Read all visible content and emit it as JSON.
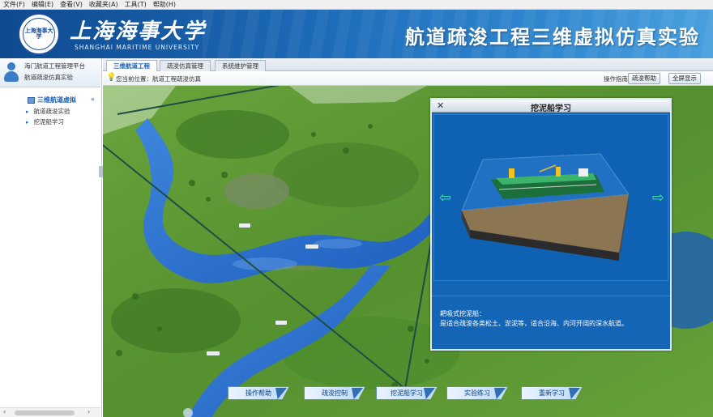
{
  "menubar": {
    "items": [
      "文件(F)",
      "编辑(E)",
      "查看(V)",
      "收藏夹(A)",
      "工具(T)",
      "帮助(H)"
    ]
  },
  "banner": {
    "seal_text": "上海海事大学",
    "university_cn": "上海海事大学",
    "university_en": "SHANGHAI MARITIME UNIVERSITY",
    "app_title": "航道疏浚工程三维虚拟仿真实验"
  },
  "sidebar": {
    "user_line1": "海门航道工程管理平台",
    "user_line2": "航道疏浚仿真实验",
    "tree_root": "三维航道虚拟",
    "collapse": "«",
    "items": [
      "航道疏浚实验",
      "挖泥船学习"
    ],
    "scroll_left": "‹",
    "scroll_right": "›"
  },
  "tabs": [
    "三维航道工程",
    "疏浚仿真管理",
    "系统维护管理"
  ],
  "toolbar": {
    "tip_icon": "lightbulb-icon",
    "tip": "您当前位置：航道工程疏浚仿真",
    "op_hint": "操作指南",
    "help": "疏浚帮助",
    "fullscreen": "全屏显示"
  },
  "popup": {
    "title": "挖泥船学习",
    "close": "✕",
    "nav_left": "⇦",
    "nav_right": "⇨",
    "desc_title": "耙吸式挖泥船：",
    "desc_body": "是适合疏浚各类松土、淤泥等，适合沿海、内河开阔的深水航道。"
  },
  "bottom_buttons": [
    "操作帮助",
    "疏浚控制",
    "挖泥船学习",
    "实验练习",
    "重新学习"
  ],
  "colors": {
    "banner": "#1d6bb8",
    "accent_blue": "#1565b6",
    "river": "#2a6fd0",
    "terrain": "#5f9a35",
    "annotation_line": "#1f4c44"
  }
}
